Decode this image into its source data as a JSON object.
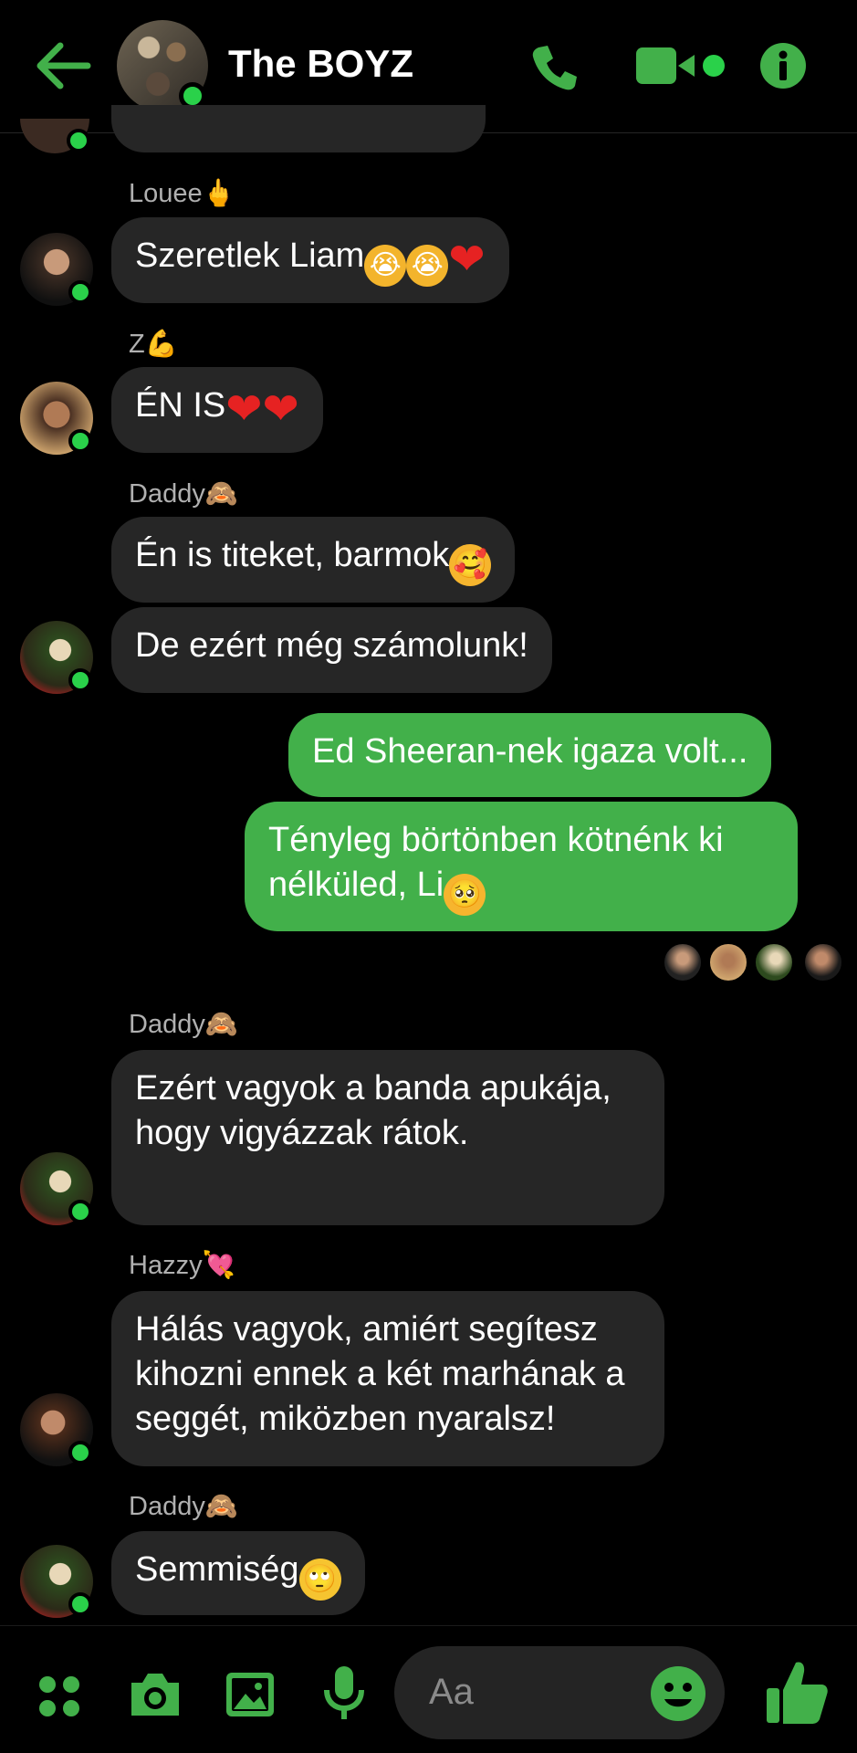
{
  "header": {
    "title": "The BOYZ",
    "back_icon": "arrow-left-icon",
    "call_icon": "phone-icon",
    "video_icon": "video-camera-icon",
    "info_icon": "info-icon",
    "accent_color": "#42b04a"
  },
  "messages": {
    "m1": {
      "sender": "Louee",
      "sender_emoji": "🖕",
      "text": "Szeretlek Liam"
    },
    "m2": {
      "sender": "Z",
      "sender_emoji": "💪",
      "text": "ÉN IS"
    },
    "m3": {
      "sender": "Daddy",
      "sender_emoji": "🙈",
      "text": "Én is titeket, barmok"
    },
    "m4": {
      "text": "De ezért még számolunk!"
    },
    "m5": {
      "text": "Ed Sheeran-nek igaza volt..."
    },
    "m6": {
      "text": "Tényleg börtönben kötnénk ki nélküled, Li"
    },
    "m7": {
      "sender": "Daddy",
      "sender_emoji": "🙈",
      "text": "Ezért vagyok a banda apukája, hogy vigyázzak rátok."
    },
    "m8": {
      "sender": "Hazzy",
      "sender_emoji": "💘",
      "text": "Hálás vagyok, amiért segítesz kihozni ennek a két marhának a seggét, miközben nyaralsz!"
    },
    "m9": {
      "sender": "Daddy",
      "sender_emoji": "🙈",
      "text": "Semmiség"
    }
  },
  "footer": {
    "input_placeholder": "Aa",
    "menu_icon": "four-dots-icon",
    "camera_icon": "camera-icon",
    "gallery_icon": "image-icon",
    "mic_icon": "microphone-icon",
    "emoji_icon": "smiley-icon",
    "like_icon": "thumbs-up-icon"
  }
}
